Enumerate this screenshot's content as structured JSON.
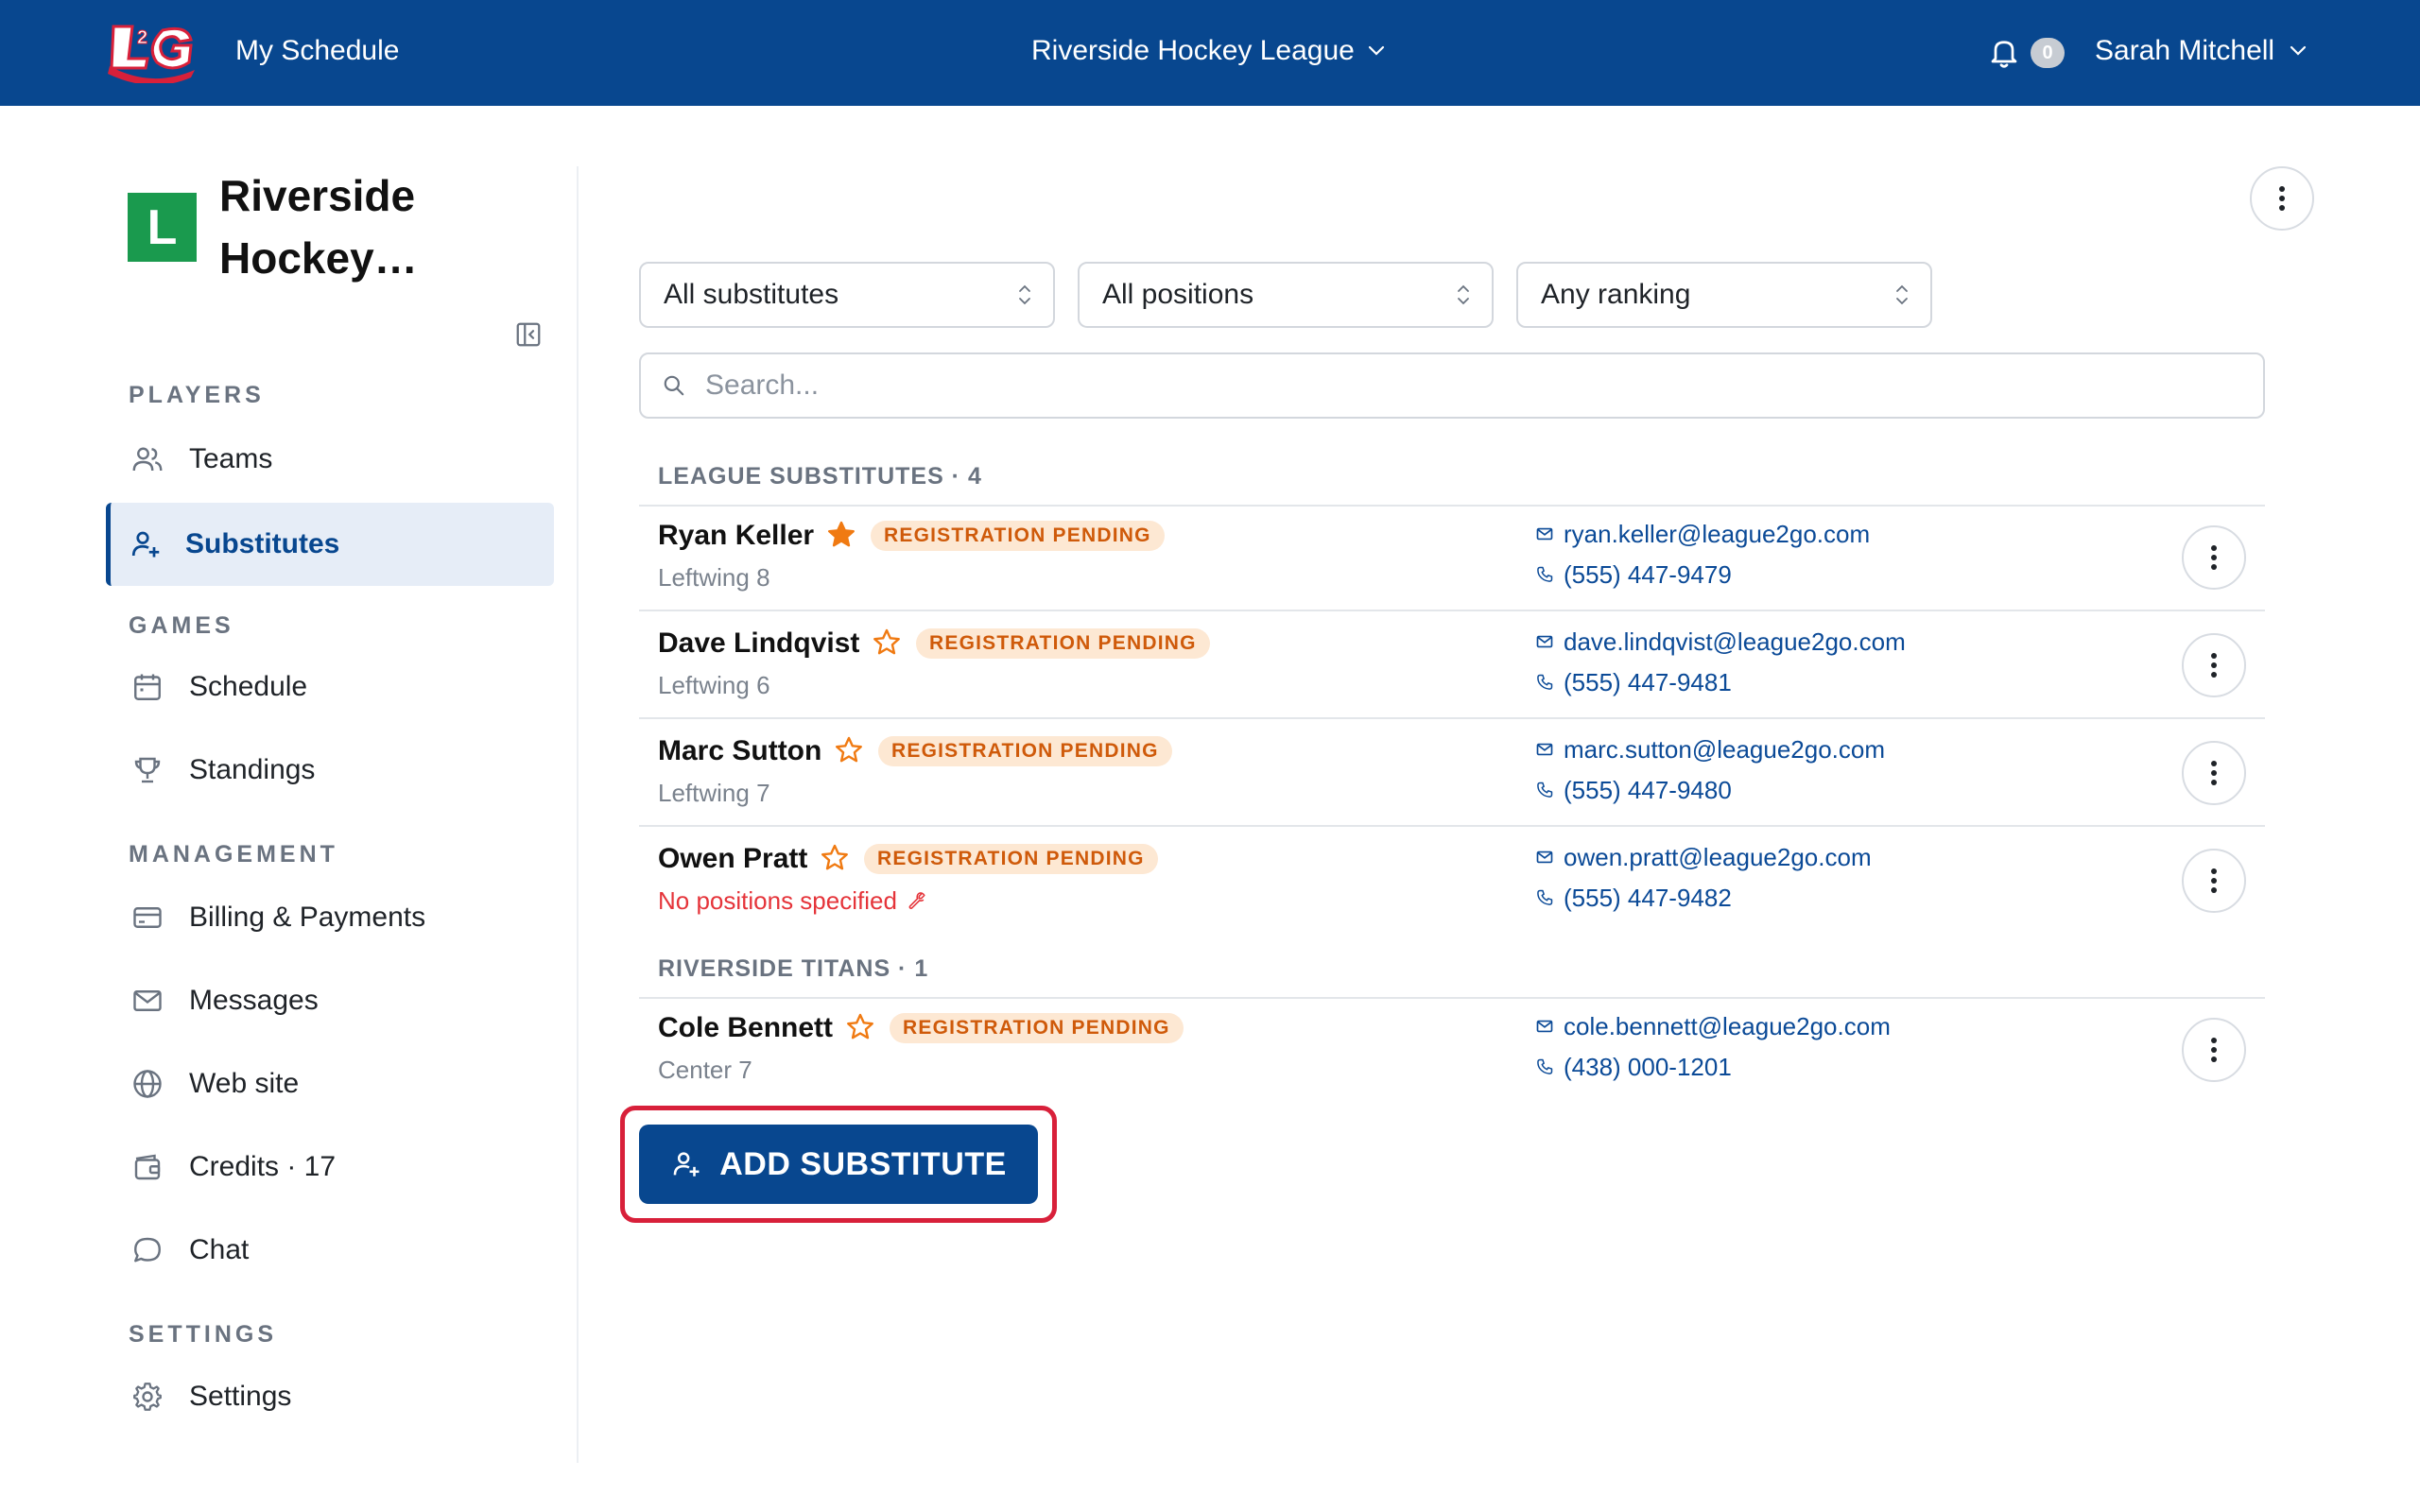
{
  "topbar": {
    "logo_text": "L2G",
    "nav_my_schedule": "My Schedule",
    "league_name": "Riverside Hockey League",
    "notifications_count": "0",
    "user_name": "Sarah Mitchell",
    "background": "#08478f"
  },
  "sidebar": {
    "org_avatar": "L",
    "org_name": "Riverside Hockey…",
    "sections": {
      "players": "PLAYERS",
      "games": "GAMES",
      "management": "MANAGEMENT",
      "settings": "SETTINGS"
    },
    "items": {
      "teams": "Teams",
      "substitutes": "Substitutes",
      "schedule": "Schedule",
      "standings": "Standings",
      "billing": "Billing & Payments",
      "messages": "Messages",
      "website": "Web site",
      "credits": "Credits · 17",
      "chat": "Chat",
      "settings": "Settings"
    },
    "active_item": "substitutes"
  },
  "filters": {
    "substitutes": "All substitutes",
    "positions": "All positions",
    "ranking": "Any ranking",
    "search_placeholder": "Search..."
  },
  "groups": [
    {
      "header": "LEAGUE SUBSTITUTES · 4",
      "players": [
        {
          "name": "Ryan Keller",
          "starred": true,
          "badge": "REGISTRATION PENDING",
          "position": "Leftwing 8",
          "email": "ryan.keller@league2go.com",
          "phone": "(555) 447-9479"
        },
        {
          "name": "Dave Lindqvist",
          "starred": false,
          "badge": "REGISTRATION PENDING",
          "position": "Leftwing 6",
          "email": "dave.lindqvist@league2go.com",
          "phone": "(555) 447-9481"
        },
        {
          "name": "Marc Sutton",
          "starred": false,
          "badge": "REGISTRATION PENDING",
          "position": "Leftwing 7",
          "email": "marc.sutton@league2go.com",
          "phone": "(555) 447-9480"
        },
        {
          "name": "Owen Pratt",
          "starred": false,
          "badge": "REGISTRATION PENDING",
          "position": "No positions specified",
          "position_warning": true,
          "email": "owen.pratt@league2go.com",
          "phone": "(555) 447-9482"
        }
      ]
    },
    {
      "header": "RIVERSIDE TITANS · 1",
      "players": [
        {
          "name": "Cole Bennett",
          "starred": false,
          "badge": "REGISTRATION PENDING",
          "position": "Center 7",
          "email": "cole.bennett@league2go.com",
          "phone": "(438) 000-1201"
        }
      ]
    }
  ],
  "add_button": "ADD SUBSTITUTE",
  "colors": {
    "primary": "#08478f",
    "star": "#f07a12",
    "badge_bg": "#fde8d3",
    "badge_text": "#cf5a0a",
    "warning": "#e5343a",
    "focus_ring": "#d8203a",
    "org_avatar": "#1a9a4e"
  }
}
